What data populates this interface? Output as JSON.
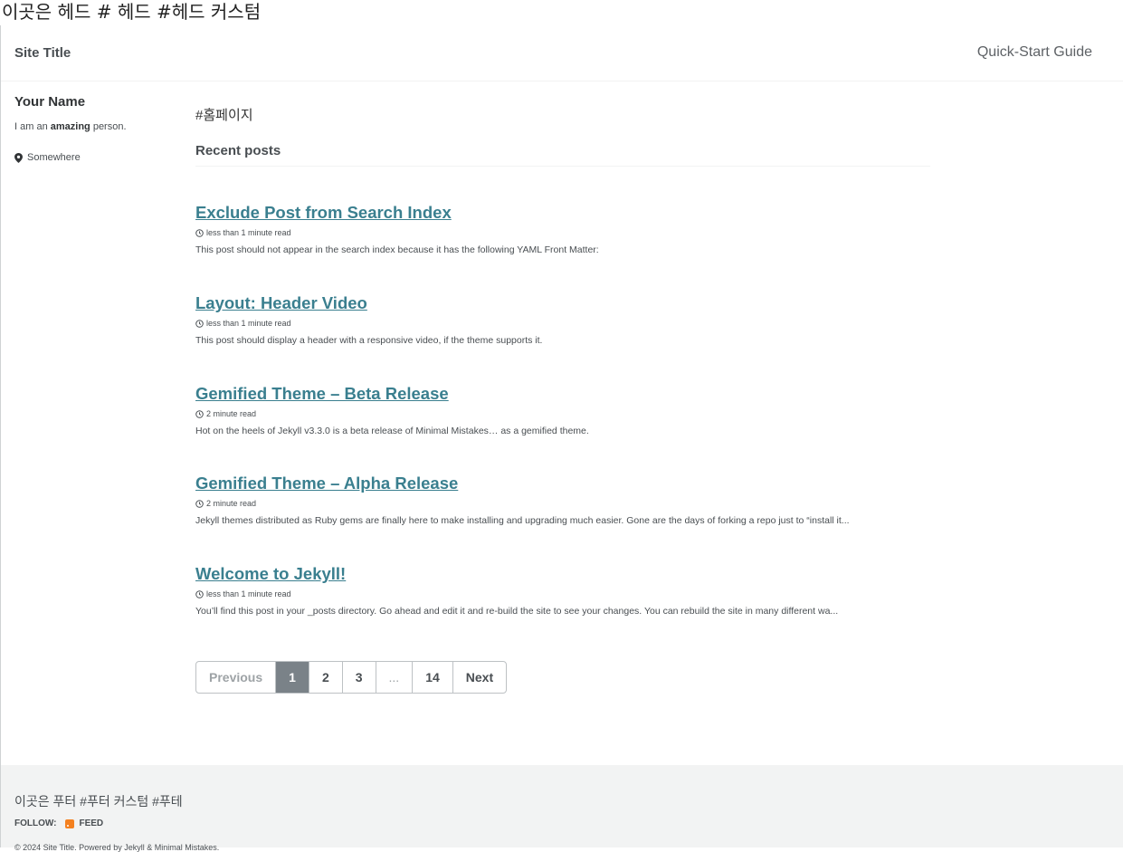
{
  "head_custom": "이곳은 헤드 # 헤드 #헤드 커스텀",
  "masthead": {
    "site_title": "Site Title",
    "nav_link": "Quick-Start Guide"
  },
  "author": {
    "name": "Your Name",
    "bio_prefix": "I am an ",
    "bio_bold": "amazing",
    "bio_suffix": " person.",
    "location": "Somewhere",
    "location_icon": "map-marker-icon"
  },
  "main": {
    "intro": "#홈페이지",
    "recent_title": "Recent posts",
    "posts": [
      {
        "title": "Exclude Post from Search Index",
        "meta": "less than 1 minute read",
        "excerpt": "This post should not appear in the search index because it has the following YAML Front Matter:"
      },
      {
        "title": "Layout: Header Video",
        "meta": "less than 1 minute read",
        "excerpt": "This post should display a header with a responsive video, if the theme supports it."
      },
      {
        "title": "Gemified Theme – Beta Release",
        "meta": "2 minute read",
        "excerpt": "Hot on the heels of Jekyll v3.3.0 is a beta release of Minimal Mistakes… as a gemified theme."
      },
      {
        "title": "Gemified Theme – Alpha Release",
        "meta": "2 minute read",
        "excerpt": "Jekyll themes distributed as Ruby gems are finally here to make installing and upgrading much easier. Gone are the days of forking a repo just to “install it..."
      },
      {
        "title": "Welcome to Jekyll!",
        "meta": "less than 1 minute read",
        "excerpt": "You’ll find this post in your _posts directory. Go ahead and edit it and re-build the site to see your changes. You can rebuild the site in many different wa..."
      }
    ]
  },
  "pagination": {
    "previous": "Previous",
    "p1": "1",
    "p2": "2",
    "p3": "3",
    "dots": "...",
    "p14": "14",
    "next": "Next"
  },
  "footer": {
    "custom": "이곳은 푸터 #푸터 커스텀 #푸테",
    "follow_label": "FOLLOW:",
    "feed_label": "FEED",
    "copyright": "© 2024 Site Title. Powered by Jekyll & Minimal Mistakes."
  },
  "colors": {
    "link": "#3a7f8f",
    "current_page": "#7a8288",
    "footer_bg": "#f2f3f3",
    "rss": "#f48120"
  }
}
